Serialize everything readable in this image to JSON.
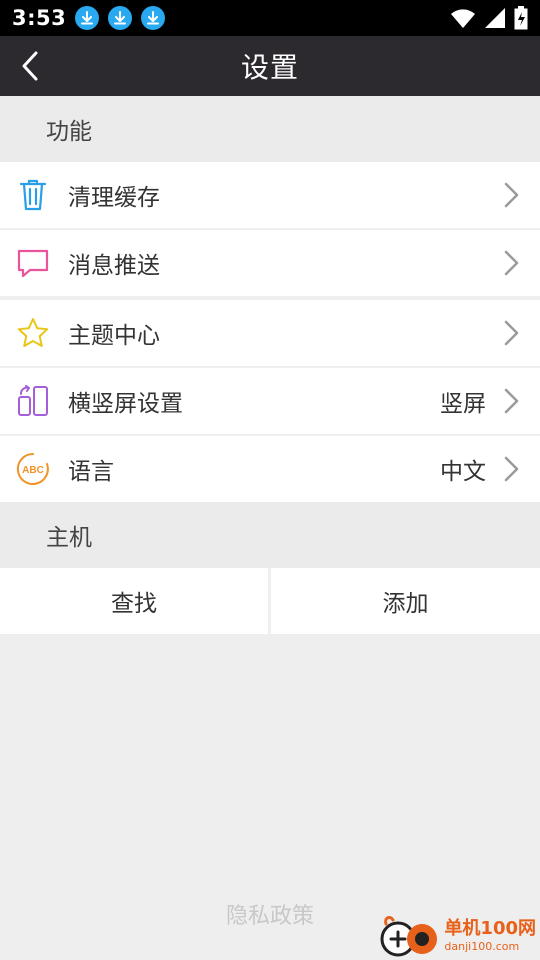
{
  "status_bar": {
    "time": "3:53"
  },
  "app_bar": {
    "title": "设置"
  },
  "sections": {
    "function": {
      "header": "功能"
    },
    "host": {
      "header": "主机"
    }
  },
  "rows": {
    "clear_cache": {
      "label": "清理缓存"
    },
    "push": {
      "label": "消息推送"
    },
    "theme": {
      "label": "主题中心"
    },
    "orientation": {
      "label": "横竖屏设置",
      "value": "竖屏"
    },
    "language": {
      "label": "语言",
      "value": "中文"
    }
  },
  "host": {
    "find_label": "查找",
    "add_label": "添加"
  },
  "footer": {
    "privacy_label": "隐私政策"
  },
  "watermark": {
    "cn": "单机100网",
    "en": "danji100.com"
  },
  "colors": {
    "status_bar": "#000000",
    "app_bar": "#2d2a2f",
    "download_icon": "#29a9f0",
    "trash_icon": "#2a9ee6",
    "message_icon": "#e8559b",
    "star_icon": "#e8c61a",
    "rotate_icon": "#a45ed8",
    "abc_icon": "#f29328"
  },
  "icons": {
    "status": [
      "download-icon",
      "download-icon",
      "download-icon",
      "wifi-icon",
      "signal-icon",
      "battery-icon"
    ],
    "rows": [
      "trash-icon",
      "message-icon",
      "star-icon",
      "screen-rotate-icon",
      "abc-language-icon"
    ]
  }
}
